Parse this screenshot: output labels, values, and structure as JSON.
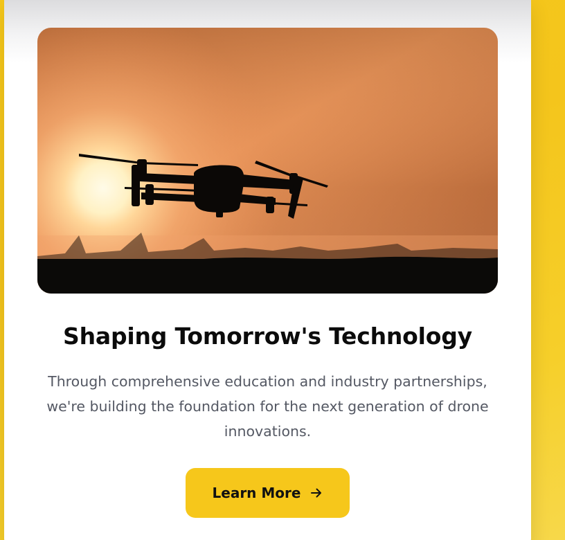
{
  "hero_image": {
    "alt": "Drone silhouette flying in front of the setting sun",
    "colors": {
      "sky_top": "#9c5a2c",
      "sky_mid": "#e0905a",
      "sky_low": "#f6a66a",
      "sun": "#fff6d6",
      "ground": "#0a0907"
    }
  },
  "content": {
    "title": "Shaping Tomorrow's Technology",
    "description": "Through comprehensive education and industry partnerships, we're building the foundation for the next generation of drone innovations.",
    "cta_label": "Learn More",
    "cta_icon": "arrow-right-icon"
  },
  "colors": {
    "page_background": "#f6c81a",
    "card_background": "#ffffff",
    "button_background": "#f6c71b",
    "title_text": "#0b0b0b",
    "body_text": "#545863"
  }
}
